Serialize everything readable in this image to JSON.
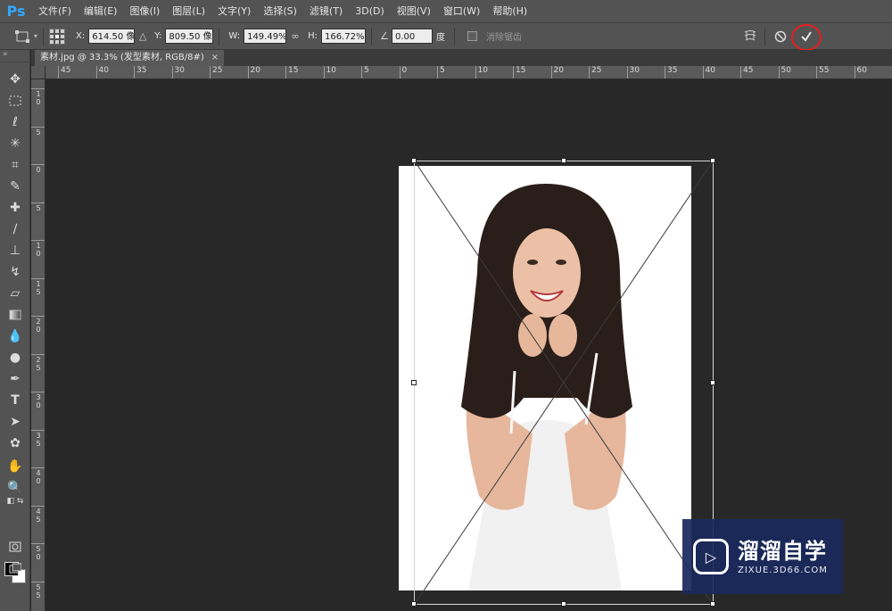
{
  "app": {
    "logo": "Ps"
  },
  "menu": [
    "文件(F)",
    "编辑(E)",
    "图像(I)",
    "图层(L)",
    "文字(Y)",
    "选择(S)",
    "滤镜(T)",
    "3D(D)",
    "视图(V)",
    "窗口(W)",
    "帮助(H)"
  ],
  "options": {
    "x_label": "X:",
    "x_value": "614.50 像",
    "y_label": "Y:",
    "y_value": "809.50 像",
    "w_label": "W:",
    "w_value": "149.49%",
    "h_label": "H:",
    "h_value": "166.72%",
    "angle_value": "0.00",
    "angle_unit": "度",
    "antialias_label": "消除锯齿"
  },
  "document": {
    "tab_title": "素材.jpg @ 33.3% (发型素材, RGB/8#)",
    "close": "×"
  },
  "ruler_h": [
    "45",
    "40",
    "35",
    "30",
    "25",
    "20",
    "15",
    "10",
    "5",
    "0",
    "5",
    "10",
    "15",
    "20",
    "25",
    "30",
    "35",
    "40",
    "45",
    "50",
    "55",
    "60"
  ],
  "ruler_v": [
    "1\n0",
    "5",
    "0",
    "5",
    "1\n0",
    "1\n5",
    "2\n0",
    "2\n5",
    "3\n0",
    "3\n5",
    "4\n0",
    "4\n5",
    "5\n0",
    "5\n5"
  ],
  "watermark": {
    "title": "溜溜自学",
    "subtitle": "ZIXUE.3D66.COM"
  },
  "colors": {
    "accent_blue": "#31a8ff",
    "commit_highlight": "#e02020",
    "watermark_bg": "#1b2a5c"
  }
}
